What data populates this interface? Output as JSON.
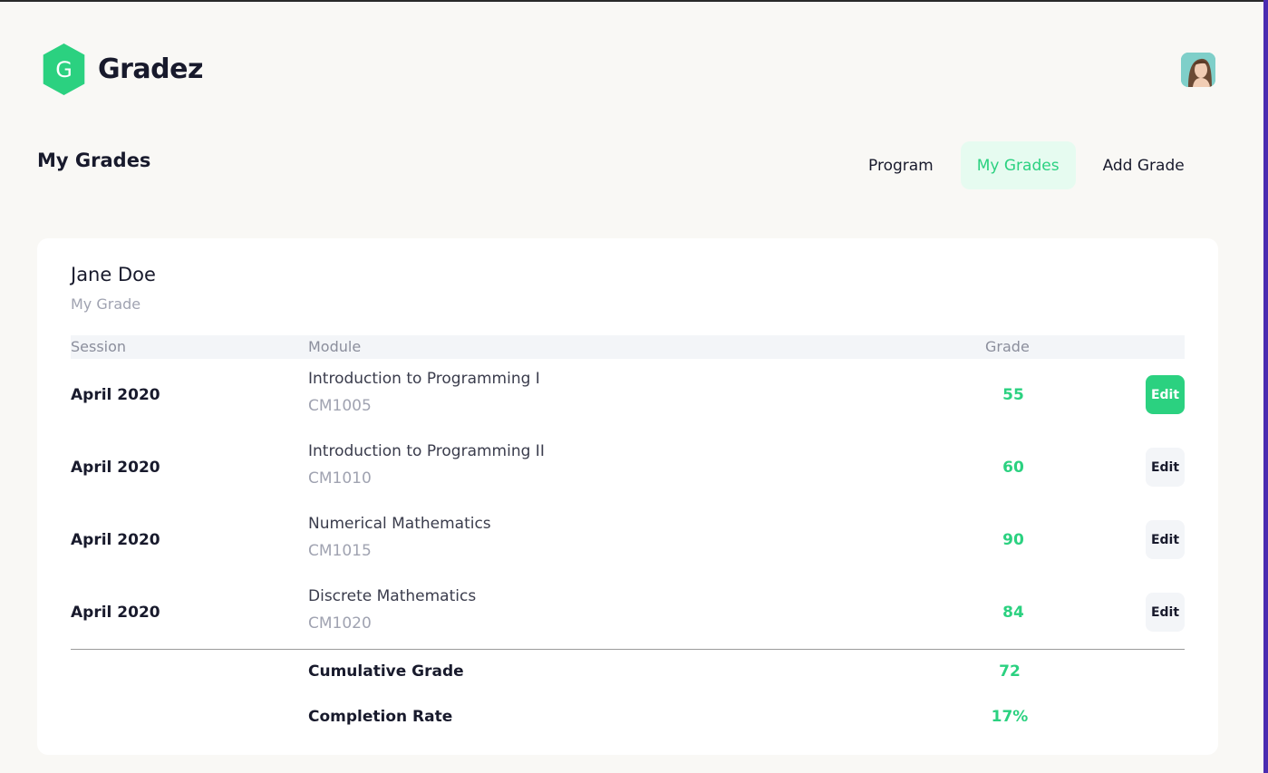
{
  "app": {
    "name": "Gradez",
    "logo_letter": "G",
    "brand_color": "#2bd180"
  },
  "header": {
    "avatar_alt": ""
  },
  "page": {
    "title": "My Grades"
  },
  "nav": {
    "items": [
      {
        "label": "Program",
        "active": false
      },
      {
        "label": "My Grades",
        "active": true
      },
      {
        "label": "Add Grade",
        "active": false
      }
    ]
  },
  "card": {
    "student_name": "Jane Doe",
    "subtitle": "My Grade",
    "columns": {
      "session": "Session",
      "module": "Module",
      "grade": "Grade"
    },
    "rows": [
      {
        "session": "April 2020",
        "module": "Introduction to Programming I",
        "code": "CM1005",
        "grade": "55",
        "action": "Edit"
      },
      {
        "session": "April 2020",
        "module": "Introduction to Programming II",
        "code": "CM1010",
        "grade": "60",
        "action": "Edit"
      },
      {
        "session": "April 2020",
        "module": "Numerical Mathematics",
        "code": "CM1015",
        "grade": "90",
        "action": "Edit"
      },
      {
        "session": "April 2020",
        "module": "Discrete Mathematics",
        "code": "CM1020",
        "grade": "84",
        "action": "Edit"
      }
    ],
    "summary": {
      "cumulative_label": "Cumulative Grade",
      "cumulative_value": "72",
      "completion_label": "Completion Rate",
      "completion_value": "17%"
    }
  }
}
